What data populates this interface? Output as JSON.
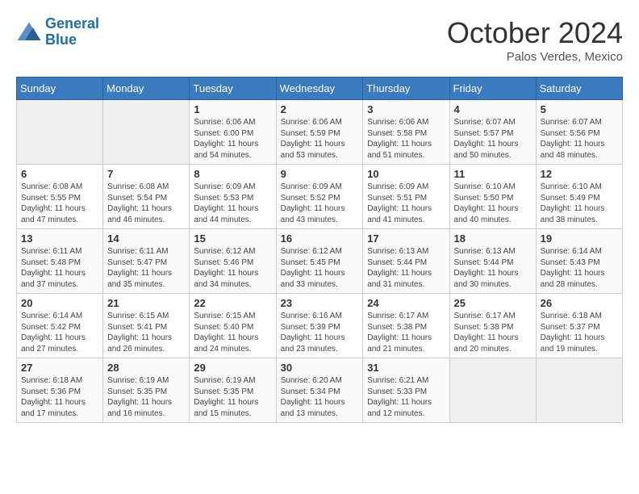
{
  "logo": {
    "line1": "General",
    "line2": "Blue"
  },
  "title": "October 2024",
  "location": "Palos Verdes, Mexico",
  "days_of_week": [
    "Sunday",
    "Monday",
    "Tuesday",
    "Wednesday",
    "Thursday",
    "Friday",
    "Saturday"
  ],
  "weeks": [
    [
      {
        "day": "",
        "info": ""
      },
      {
        "day": "",
        "info": ""
      },
      {
        "day": "1",
        "info": "Sunrise: 6:06 AM\nSunset: 6:00 PM\nDaylight: 11 hours and 54 minutes."
      },
      {
        "day": "2",
        "info": "Sunrise: 6:06 AM\nSunset: 5:59 PM\nDaylight: 11 hours and 53 minutes."
      },
      {
        "day": "3",
        "info": "Sunrise: 6:06 AM\nSunset: 5:58 PM\nDaylight: 11 hours and 51 minutes."
      },
      {
        "day": "4",
        "info": "Sunrise: 6:07 AM\nSunset: 5:57 PM\nDaylight: 11 hours and 50 minutes."
      },
      {
        "day": "5",
        "info": "Sunrise: 6:07 AM\nSunset: 5:56 PM\nDaylight: 11 hours and 48 minutes."
      }
    ],
    [
      {
        "day": "6",
        "info": "Sunrise: 6:08 AM\nSunset: 5:55 PM\nDaylight: 11 hours and 47 minutes."
      },
      {
        "day": "7",
        "info": "Sunrise: 6:08 AM\nSunset: 5:54 PM\nDaylight: 11 hours and 46 minutes."
      },
      {
        "day": "8",
        "info": "Sunrise: 6:09 AM\nSunset: 5:53 PM\nDaylight: 11 hours and 44 minutes."
      },
      {
        "day": "9",
        "info": "Sunrise: 6:09 AM\nSunset: 5:52 PM\nDaylight: 11 hours and 43 minutes."
      },
      {
        "day": "10",
        "info": "Sunrise: 6:09 AM\nSunset: 5:51 PM\nDaylight: 11 hours and 41 minutes."
      },
      {
        "day": "11",
        "info": "Sunrise: 6:10 AM\nSunset: 5:50 PM\nDaylight: 11 hours and 40 minutes."
      },
      {
        "day": "12",
        "info": "Sunrise: 6:10 AM\nSunset: 5:49 PM\nDaylight: 11 hours and 38 minutes."
      }
    ],
    [
      {
        "day": "13",
        "info": "Sunrise: 6:11 AM\nSunset: 5:48 PM\nDaylight: 11 hours and 37 minutes."
      },
      {
        "day": "14",
        "info": "Sunrise: 6:11 AM\nSunset: 5:47 PM\nDaylight: 11 hours and 35 minutes."
      },
      {
        "day": "15",
        "info": "Sunrise: 6:12 AM\nSunset: 5:46 PM\nDaylight: 11 hours and 34 minutes."
      },
      {
        "day": "16",
        "info": "Sunrise: 6:12 AM\nSunset: 5:45 PM\nDaylight: 11 hours and 33 minutes."
      },
      {
        "day": "17",
        "info": "Sunrise: 6:13 AM\nSunset: 5:44 PM\nDaylight: 11 hours and 31 minutes."
      },
      {
        "day": "18",
        "info": "Sunrise: 6:13 AM\nSunset: 5:44 PM\nDaylight: 11 hours and 30 minutes."
      },
      {
        "day": "19",
        "info": "Sunrise: 6:14 AM\nSunset: 5:43 PM\nDaylight: 11 hours and 28 minutes."
      }
    ],
    [
      {
        "day": "20",
        "info": "Sunrise: 6:14 AM\nSunset: 5:42 PM\nDaylight: 11 hours and 27 minutes."
      },
      {
        "day": "21",
        "info": "Sunrise: 6:15 AM\nSunset: 5:41 PM\nDaylight: 11 hours and 26 minutes."
      },
      {
        "day": "22",
        "info": "Sunrise: 6:15 AM\nSunset: 5:40 PM\nDaylight: 11 hours and 24 minutes."
      },
      {
        "day": "23",
        "info": "Sunrise: 6:16 AM\nSunset: 5:39 PM\nDaylight: 11 hours and 23 minutes."
      },
      {
        "day": "24",
        "info": "Sunrise: 6:17 AM\nSunset: 5:38 PM\nDaylight: 11 hours and 21 minutes."
      },
      {
        "day": "25",
        "info": "Sunrise: 6:17 AM\nSunset: 5:38 PM\nDaylight: 11 hours and 20 minutes."
      },
      {
        "day": "26",
        "info": "Sunrise: 6:18 AM\nSunset: 5:37 PM\nDaylight: 11 hours and 19 minutes."
      }
    ],
    [
      {
        "day": "27",
        "info": "Sunrise: 6:18 AM\nSunset: 5:36 PM\nDaylight: 11 hours and 17 minutes."
      },
      {
        "day": "28",
        "info": "Sunrise: 6:19 AM\nSunset: 5:35 PM\nDaylight: 11 hours and 16 minutes."
      },
      {
        "day": "29",
        "info": "Sunrise: 6:19 AM\nSunset: 5:35 PM\nDaylight: 11 hours and 15 minutes."
      },
      {
        "day": "30",
        "info": "Sunrise: 6:20 AM\nSunset: 5:34 PM\nDaylight: 11 hours and 13 minutes."
      },
      {
        "day": "31",
        "info": "Sunrise: 6:21 AM\nSunset: 5:33 PM\nDaylight: 11 hours and 12 minutes."
      },
      {
        "day": "",
        "info": ""
      },
      {
        "day": "",
        "info": ""
      }
    ]
  ]
}
